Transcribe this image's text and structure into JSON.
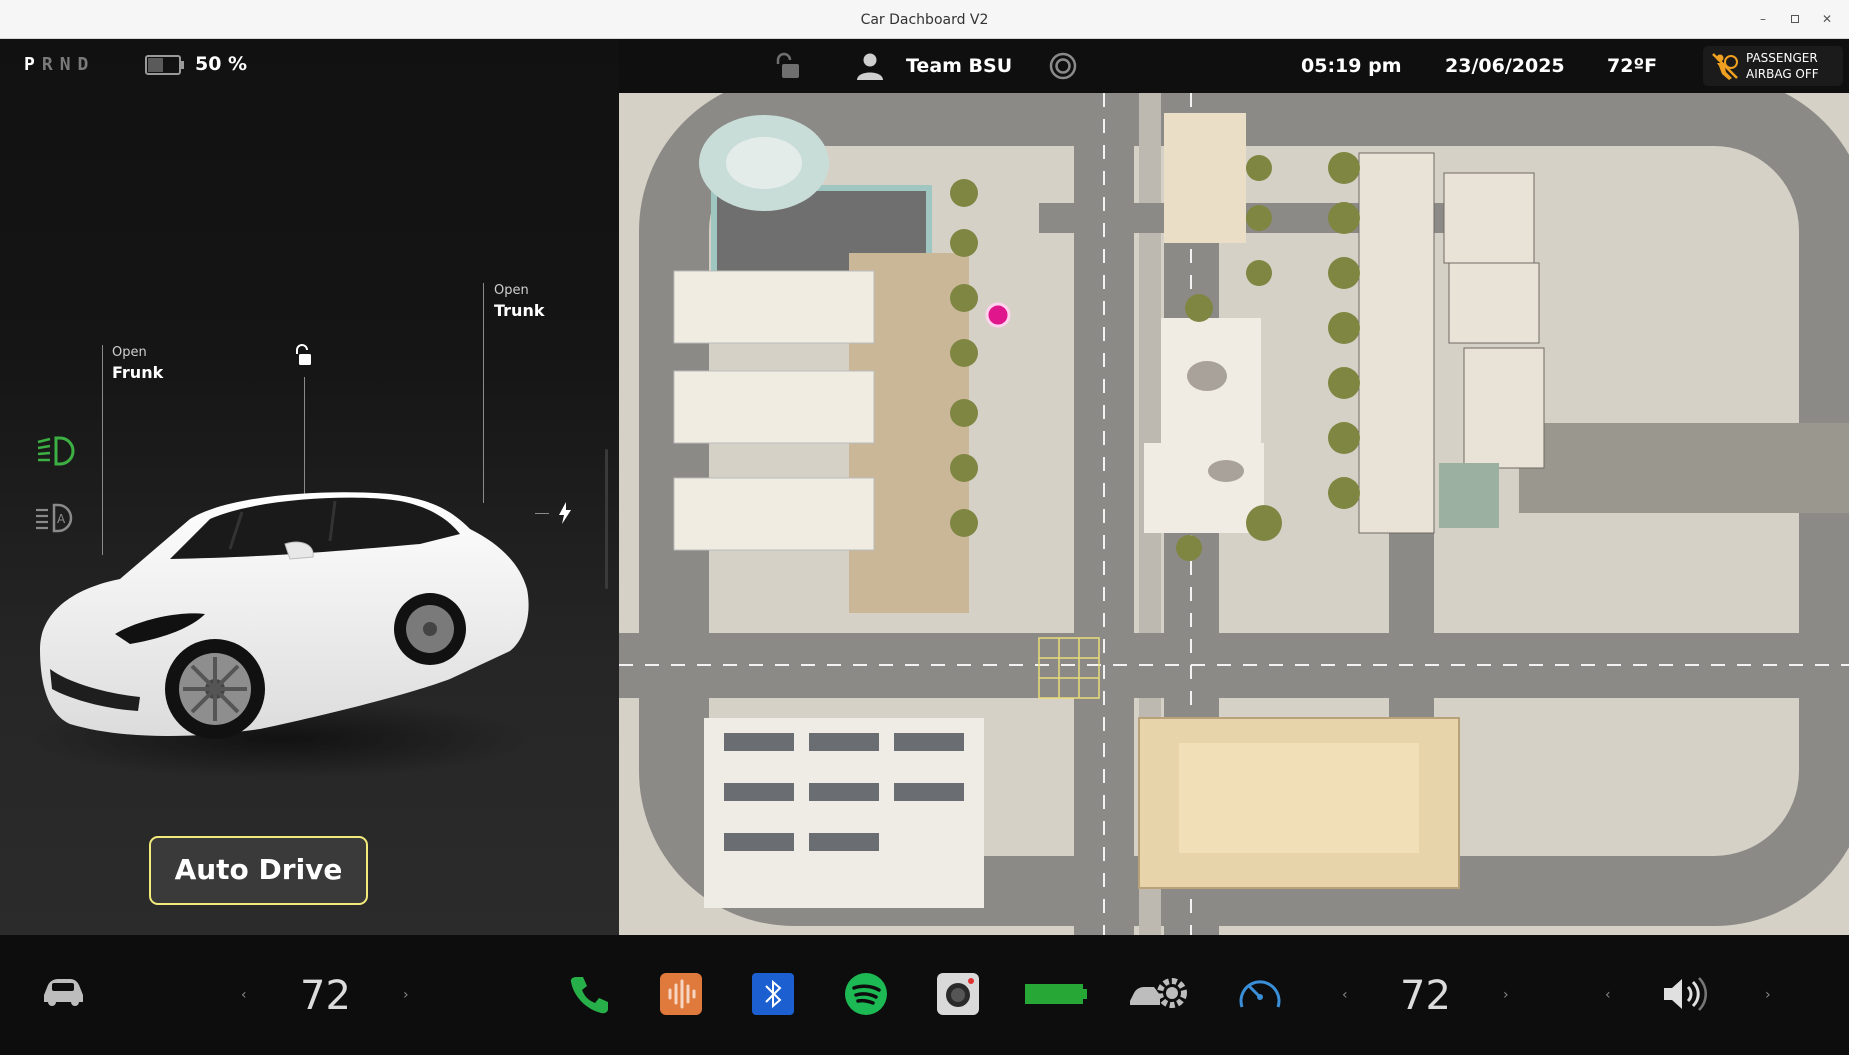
{
  "window": {
    "title": "Car Dachboard V2",
    "controls": [
      "minimize-icon",
      "restore-icon",
      "close-icon"
    ]
  },
  "gear": {
    "letters": [
      "P",
      "R",
      "N",
      "D"
    ],
    "active": "P"
  },
  "battery": {
    "percent_label": "50 %",
    "level": 0.5
  },
  "callouts": {
    "frunk": {
      "label": "Open",
      "value": "Frunk"
    },
    "trunk": {
      "label": "Open",
      "value": "Trunk"
    }
  },
  "controls": {
    "auto_drive_label": "Auto Drive"
  },
  "status": {
    "user": "Team BSU",
    "time": "05:19 pm",
    "date": "23/06/2025",
    "temperature": "72ºF",
    "airbag_line1": "PASSENGER",
    "airbag_line2": "AIRBAG OFF"
  },
  "bottom": {
    "left_temp": "72",
    "right_temp": "72",
    "chev_left": "‹",
    "chev_right": "›",
    "apps": [
      "car-icon",
      "phone-icon",
      "voice-icon",
      "bluetooth-icon",
      "spotify-icon",
      "camera-icon",
      "battery-status-icon",
      "car-settings-icon",
      "speedometer-icon",
      "volume-icon"
    ]
  },
  "colors": {
    "accent_yellow": "#f2ea7a",
    "headlight_green": "#3cb043",
    "bluetooth_blue": "#1c5fd0",
    "spotify_green": "#1db954",
    "phone_green": "#27b04a",
    "voice_orange": "#e07a3c",
    "battery_green": "#27a836",
    "speedo_blue": "#3a8fd8",
    "location_pink": "#e0168c"
  }
}
